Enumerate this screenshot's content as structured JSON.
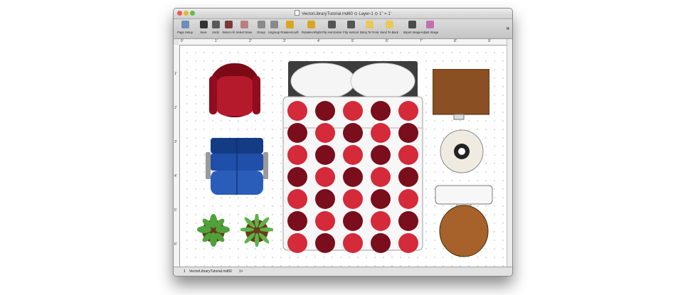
{
  "window": {
    "title": "VectorLibraryTutorial.md60 ⊙ Layer-1 ⊙ 1\" = 1'",
    "traffic_colors": [
      "#ee5b55",
      "#e9b62f",
      "#5dbd48"
    ]
  },
  "toolbar": {
    "items": [
      {
        "label": "Page Setup",
        "icon": "page-setup-icon",
        "color": "#6d8fb7"
      },
      {
        "label": "Save",
        "icon": "save-icon",
        "color": "#333333"
      },
      {
        "label": "Undo",
        "icon": "undo-icon",
        "color": "#5a5a5a"
      },
      {
        "label": "Select All",
        "icon": "select-all-icon",
        "color": "#7a3a3a"
      },
      {
        "label": "Select None",
        "icon": "select-none-icon",
        "color": "#b98080"
      },
      {
        "label": "Group",
        "icon": "group-icon",
        "color": "#8a8a8a"
      },
      {
        "label": "Ungroup",
        "icon": "ungroup-icon",
        "color": "#8a8a8a"
      },
      {
        "label": "RotateHALeft",
        "icon": "rotate-left-icon",
        "color": "#d9a622"
      },
      {
        "label": "RotateHARight",
        "icon": "rotate-right-icon",
        "color": "#d9a622"
      },
      {
        "label": "Flip Horizontal",
        "icon": "flip-horizontal-icon",
        "color": "#555555"
      },
      {
        "label": "Flip Vertical",
        "icon": "flip-vertical-icon",
        "color": "#555555"
      },
      {
        "label": "Bring To Front",
        "icon": "bring-to-front-icon",
        "color": "#e8c95a"
      },
      {
        "label": "Send To Back",
        "icon": "send-to-back-icon",
        "color": "#e8c95a"
      },
      {
        "label": "Import Image",
        "icon": "import-image-icon",
        "color": "#4b4b4b"
      },
      {
        "label": "Adjust Image",
        "icon": "adjust-image-icon",
        "color": "#c070b0"
      }
    ],
    "overflow": "»"
  },
  "ruler": {
    "top_labels": [
      "0'",
      "1'",
      "2'",
      "3'",
      "4'",
      "5'",
      "6'",
      "7'",
      "8'",
      "9'"
    ],
    "left_labels": [
      "1'",
      "2'",
      "3'",
      "4'",
      "5'",
      "6'"
    ]
  },
  "status": {
    "page": "1",
    "file": "VectorLibraryTutorial.md60",
    "zoom": "1×"
  },
  "colors": {
    "chair_red": "#a31020",
    "sofa_blue": "#1f4fa8",
    "table_wood": "#8a4f22",
    "toilet_wood": "#a6622a",
    "dot_red": "#d42a3a",
    "dot_dark": "#7a0e1c",
    "plant_green": "#4fa23a"
  }
}
